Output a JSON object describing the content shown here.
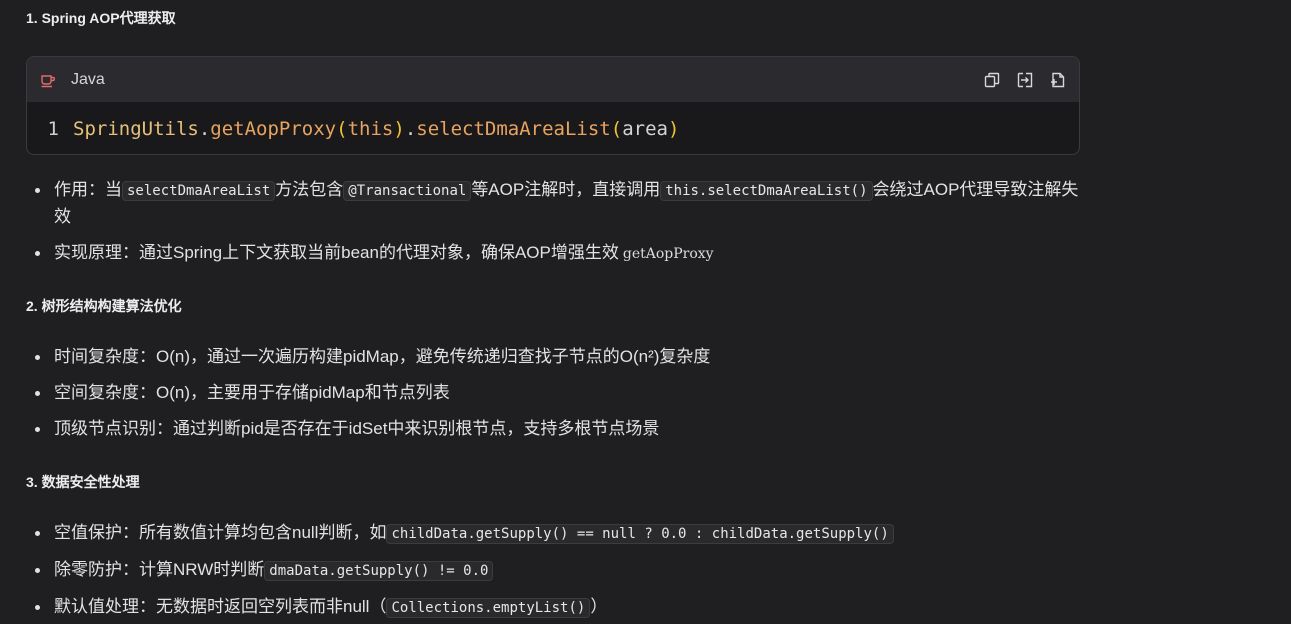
{
  "sections": {
    "s1": {
      "title": "1. Spring AOP代理获取",
      "code": {
        "language": "Java",
        "line_number": "1",
        "tokens": {
          "cls": "SpringUtils",
          "dot1": ".",
          "fn1": "getAopProxy",
          "lp1": "(",
          "kw": "this",
          "rp1": ")",
          "dot2": ".",
          "fn2": "selectDmaAreaList",
          "lp2": "(",
          "arg": "area",
          "rp2": ")"
        },
        "tools": [
          "copy-icon",
          "insert-icon",
          "new-file-icon"
        ]
      },
      "bullets": {
        "b1": {
          "t1": "作用：当",
          "c1": "selectDmaAreaList",
          "t2": "方法包含",
          "c2": "@Transactional",
          "t3": "等AOP注解时，直接调用",
          "c3": "this.selectDmaAreaList()",
          "t4": "会绕过AOP代理导致注解失效"
        },
        "b2": {
          "t1": "实现原理：通过Spring上下文获取当前bean的代理对象，确保AOP增强生效",
          "m1": "getAopProxy"
        }
      }
    },
    "s2": {
      "title": "2. 树形结构构建算法优化",
      "bullets": [
        "时间复杂度：O(n)，通过一次遍历构建pidMap，避免传统递归查找子节点的O(n²)复杂度",
        "空间复杂度：O(n)，主要用于存储pidMap和节点列表",
        "顶级节点识别：通过判断pid是否存在于idSet中来识别根节点，支持多根节点场景"
      ]
    },
    "s3": {
      "title": "3. 数据安全性处理",
      "bullets": {
        "b1": {
          "t1": "空值保护：所有数值计算均包含null判断，如",
          "c1": "childData.getSupply() == null ? 0.0 : childData.getSupply()"
        },
        "b2": {
          "t1": "除零防护：计算NRW时判断",
          "c1": "dmaData.getSupply() != 0.0"
        },
        "b3": {
          "t1": "默认值处理：无数据时返回空列表而非null（",
          "c1": "Collections.emptyList()",
          "t2": "）"
        }
      }
    }
  },
  "colors": {
    "background": "#1f1f22",
    "code_header": "#2b2b2f",
    "java_icon": "#e26a6a"
  }
}
